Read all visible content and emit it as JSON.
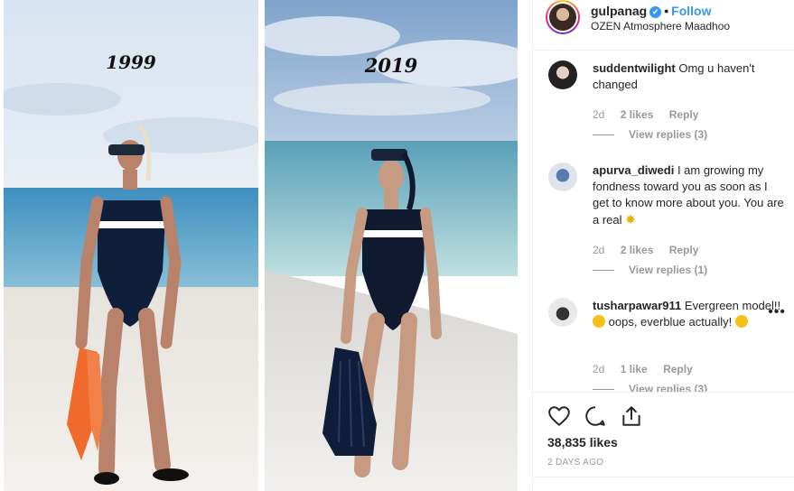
{
  "photos": {
    "left_year": "1999",
    "right_year": "2019"
  },
  "header": {
    "username": "gulpanag",
    "verified_badge": "✔",
    "separator": "•",
    "follow_label": "Follow",
    "location": "OZEN Atmosphere Maadhoo"
  },
  "comments": [
    {
      "user": "suddentwilight",
      "text": "Omg u haven't changed",
      "age": "2d",
      "likes": "2 likes",
      "reply": "Reply",
      "view_replies": "View replies (3)"
    },
    {
      "user": "apurva_diwedi",
      "text": "I am growing my fondness toward you as soon as I get to know more about you. You are a real",
      "emoji": "✸",
      "age": "2d",
      "likes": "2 likes",
      "reply": "Reply",
      "view_replies": "View replies (1)"
    },
    {
      "user": "tusharpawar911",
      "text_a": "Evergreen model!!",
      "text_b": "oops, everblue actually!",
      "age": "2d",
      "likes": "1 like",
      "reply": "Reply",
      "view_replies": "View replies (3)",
      "more": "•••"
    }
  ],
  "actions": {
    "likes_count": "38,835 likes",
    "post_age": "2 DAYS AGO",
    "icons": [
      "heart-icon",
      "comment-icon",
      "share-icon"
    ]
  },
  "colors": {
    "accent": "#3897f0",
    "muted": "#999999",
    "text": "#262626"
  }
}
